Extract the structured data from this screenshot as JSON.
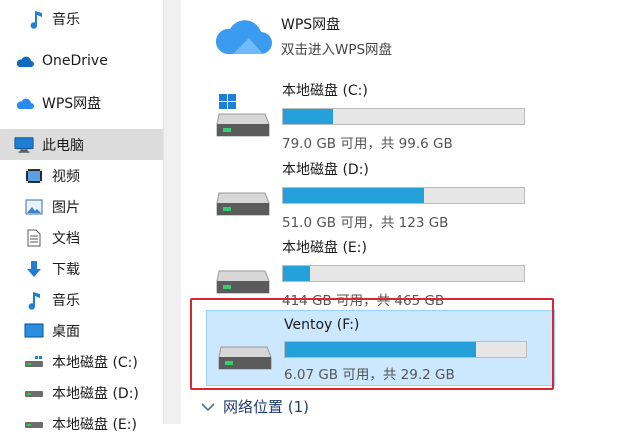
{
  "nav": {
    "items": [
      {
        "label": "音乐",
        "icon": "music-icon"
      },
      {
        "label": "OneDrive",
        "icon": "onedrive-cloud-icon"
      },
      {
        "label": "WPS网盘",
        "icon": "wps-cloud-icon"
      },
      {
        "label": "此电脑",
        "icon": "this-pc-icon",
        "selected": true
      },
      {
        "label": "视频",
        "icon": "video-icon"
      },
      {
        "label": "图片",
        "icon": "pictures-icon"
      },
      {
        "label": "文档",
        "icon": "documents-icon"
      },
      {
        "label": "下载",
        "icon": "downloads-icon"
      },
      {
        "label": "音乐",
        "icon": "music-icon"
      },
      {
        "label": "桌面",
        "icon": "desktop-icon"
      },
      {
        "label": "本地磁盘 (C:)",
        "icon": "drive-icon"
      },
      {
        "label": "本地磁盘 (D:)",
        "icon": "drive-icon"
      },
      {
        "label": "本地磁盘 (E:)",
        "icon": "drive-icon"
      }
    ]
  },
  "wps": {
    "name": "WPS网盘",
    "subtitle": "双击进入WPS网盘"
  },
  "drives": [
    {
      "name": "本地磁盘 (C:)",
      "free": "79.0 GB 可用，共 99.6 GB",
      "used_fraction": 0.207,
      "system": true
    },
    {
      "name": "本地磁盘 (D:)",
      "free": "51.0 GB 可用，共 123 GB",
      "used_fraction": 0.585
    },
    {
      "name": "本地磁盘 (E:)",
      "free": "414 GB 可用，共 465 GB",
      "used_fraction": 0.11
    },
    {
      "name": "Ventoy (F:)",
      "free": "6.07 GB 可用，共 29.2 GB",
      "used_fraction": 0.792,
      "selected": true
    }
  ],
  "network_group": {
    "label": "网络位置 (1)"
  },
  "colors": {
    "accent": "#26a0da",
    "selection": "#cce8ff",
    "highlight_border": "#d8282f"
  }
}
